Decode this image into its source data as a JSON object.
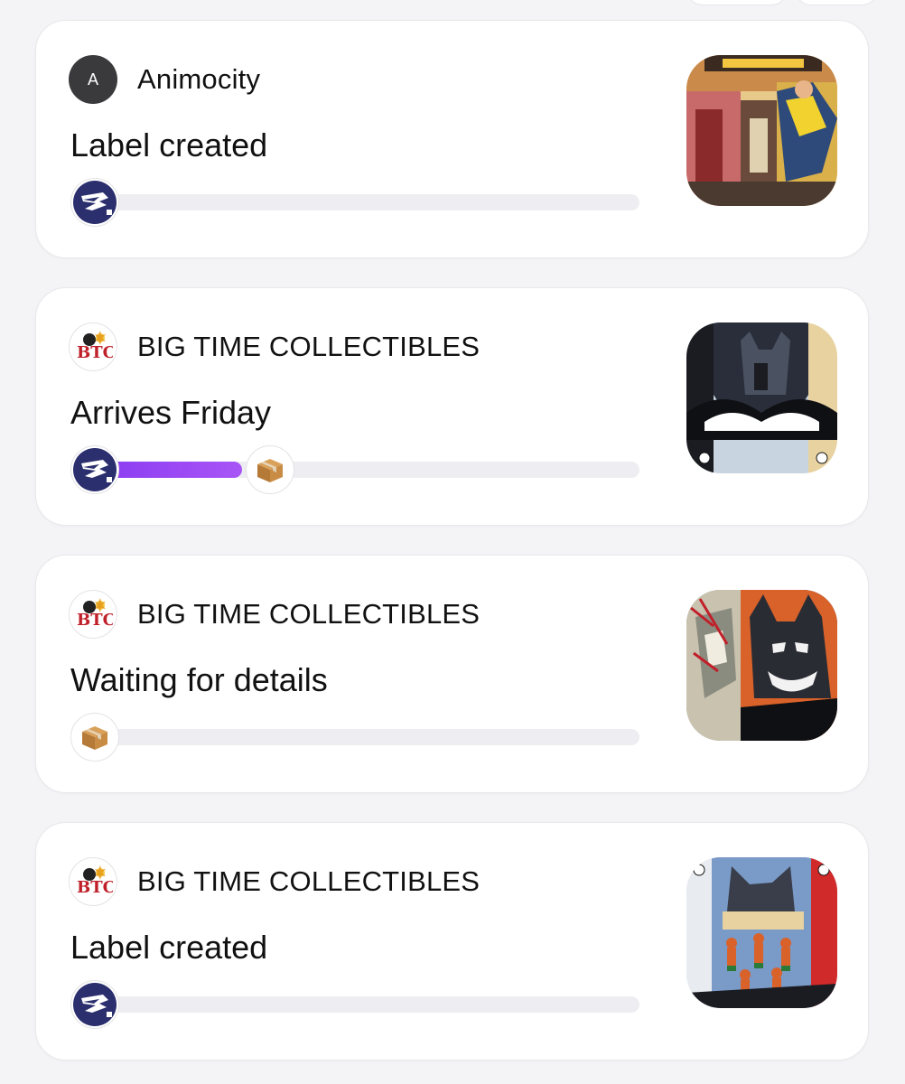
{
  "icons": {
    "carrier": "usps-eagle-icon",
    "package": "cardboard-box-icon",
    "btc_logo": "big-time-collectibles-logo"
  },
  "colors": {
    "progress_fill": "#9b4cf5",
    "track_bg": "#eeeef2",
    "usps_navy": "#2b2f6e",
    "card_bg": "#ffffff",
    "page_bg": "#f4f4f6"
  },
  "shipments": [
    {
      "merchant_initial": "A",
      "merchant_name": "Animocity",
      "status": "Label created",
      "progress": 0,
      "thumbnail": "comic-cover-invincible"
    },
    {
      "merchant_initial": "BTC",
      "merchant_name": "BIG TIME COLLECTIBLES",
      "status": "Arrives Friday",
      "progress": 0.3,
      "thumbnail": "comic-cover-batman-triptych"
    },
    {
      "merchant_initial": "BTC",
      "merchant_name": "BIG TIME COLLECTIBLES",
      "status": "Waiting for details",
      "progress": 0,
      "thumbnail": "comic-cover-batman-joker"
    },
    {
      "merchant_initial": "BTC",
      "merchant_name": "BIG TIME COLLECTIBLES",
      "status": "Label created",
      "progress": 0,
      "thumbnail": "comic-cover-batman-robins"
    }
  ]
}
